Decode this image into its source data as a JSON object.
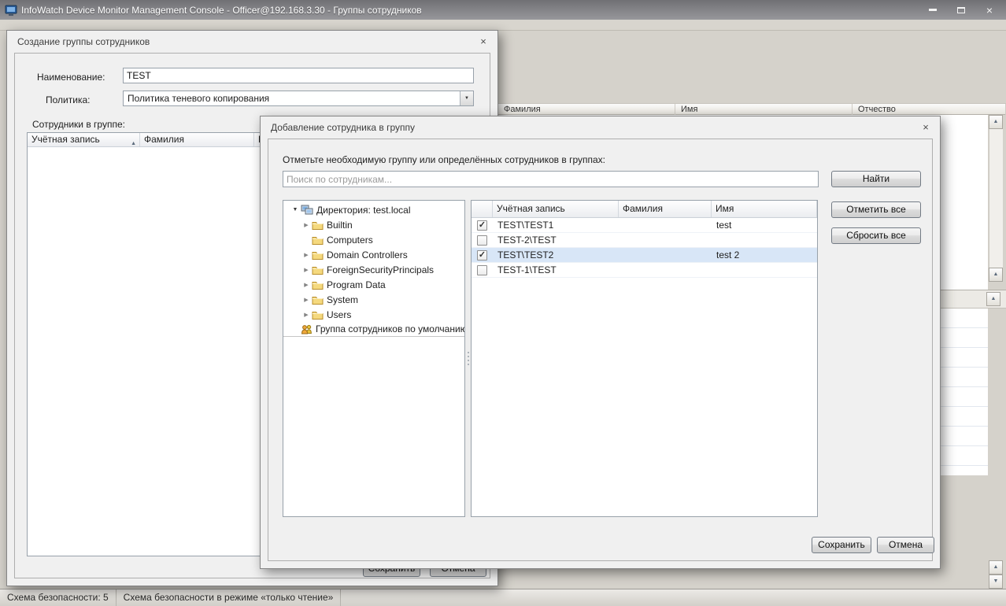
{
  "window": {
    "title": "InfoWatch Device Monitor Management Console - Officer@192.168.3.30 - Группы сотрудников"
  },
  "icons": {
    "close": "×",
    "sort_asc": "▲",
    "combo_arrow": "▼",
    "tree_expanded": "▼",
    "tree_collapsed": "▶",
    "check": "✓",
    "scroll_up": "▲",
    "scroll_down": "▼",
    "collapse_pane": "▲"
  },
  "background": {
    "columns": [
      "Фамилия",
      "Имя",
      "Отчество"
    ]
  },
  "statusbar": {
    "security_scheme": "Схема безопасности: 5",
    "mode": "Схема безопасности в режиме «только чтение»"
  },
  "create_dialog": {
    "title": "Создание группы сотрудников",
    "name_label": "Наименование:",
    "name_value": "TEST",
    "policy_label": "Политика:",
    "policy_value": "Политика теневого копирования",
    "members_label": "Сотрудники в группе:",
    "columns": [
      "Учётная запись",
      "Фамилия",
      "И"
    ],
    "save_button": "Сохранить",
    "cancel_button": "Отмена"
  },
  "add_dialog": {
    "title": "Добавление сотрудника в группу",
    "instruction": "Отметьте необходимую группу или определённых сотрудников в группах:",
    "search_placeholder": "Поиск по сотрудникам...",
    "find_button": "Найти",
    "select_all_button": "Отметить все",
    "clear_all_button": "Сбросить все",
    "save_button": "Сохранить",
    "cancel_button": "Отмена",
    "tree": {
      "root": "Директория: test.local",
      "folders": [
        "Builtin",
        "Computers",
        "Domain Controllers",
        "ForeignSecurityPrincipals",
        "Program Data",
        "System",
        "Users"
      ],
      "default_group": "Группа сотрудников по умолчанию"
    },
    "columns": [
      "Учётная запись",
      "Фамилия",
      "Имя"
    ],
    "rows": [
      {
        "checked": true,
        "selected": false,
        "account": "TEST\\TEST1",
        "surname": "",
        "name": "test"
      },
      {
        "checked": false,
        "selected": false,
        "account": "TEST-2\\TEST",
        "surname": "",
        "name": ""
      },
      {
        "checked": true,
        "selected": true,
        "account": "TEST\\TEST2",
        "surname": "",
        "name": "test 2"
      },
      {
        "checked": false,
        "selected": false,
        "account": "TEST-1\\TEST",
        "surname": "",
        "name": ""
      }
    ]
  }
}
